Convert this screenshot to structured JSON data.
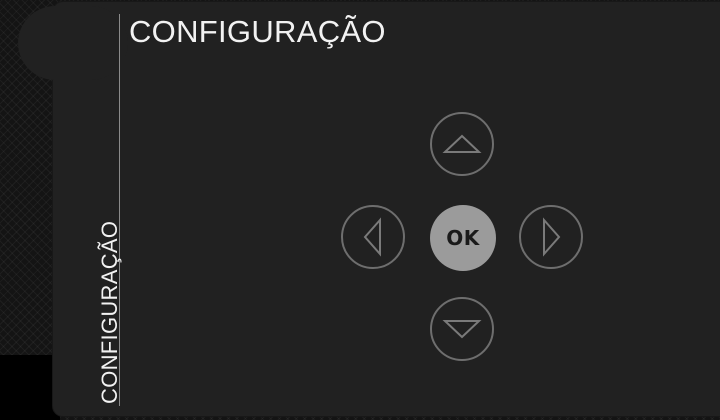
{
  "menu": {
    "title": "CONFIGURAÇÃO",
    "side_label": "CONFIGURAÇÃO"
  },
  "dpad": {
    "ok_label": "OK",
    "up_icon": "triangle-up-icon",
    "down_icon": "triangle-down-icon",
    "left_icon": "triangle-left-icon",
    "right_icon": "triangle-right-icon"
  },
  "colors": {
    "panel": "#212121",
    "ring": "#6e6e6e",
    "ok_fill": "#9b9b9b",
    "text": "#f2f2f2"
  }
}
